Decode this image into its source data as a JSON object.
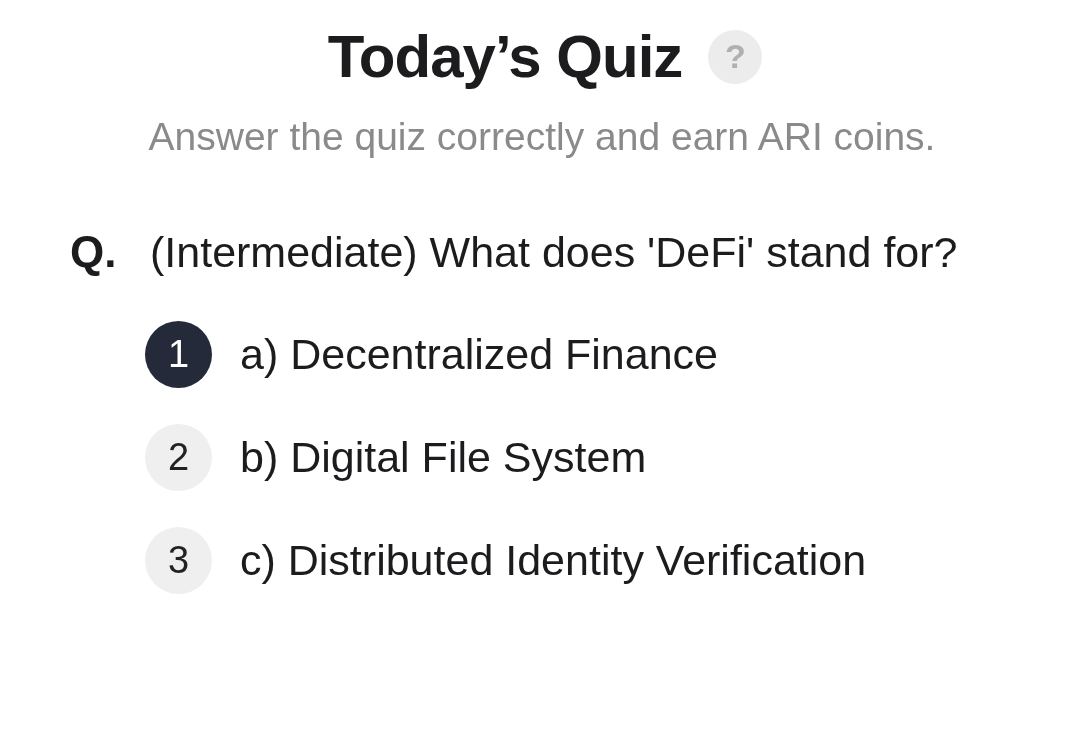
{
  "header": {
    "title": "Today’s Quiz",
    "help_icon": "?",
    "subtitle": "Answer the quiz correctly and earn ARI coins."
  },
  "question": {
    "prefix": "Q.",
    "text": "(Intermediate) What does 'DeFi' stand for?"
  },
  "options": [
    {
      "number": "1",
      "label": "a) Decentralized Finance",
      "selected": true
    },
    {
      "number": "2",
      "label": "b) Digital File System",
      "selected": false
    },
    {
      "number": "3",
      "label": "c) Distributed Identity Verification",
      "selected": false
    }
  ]
}
